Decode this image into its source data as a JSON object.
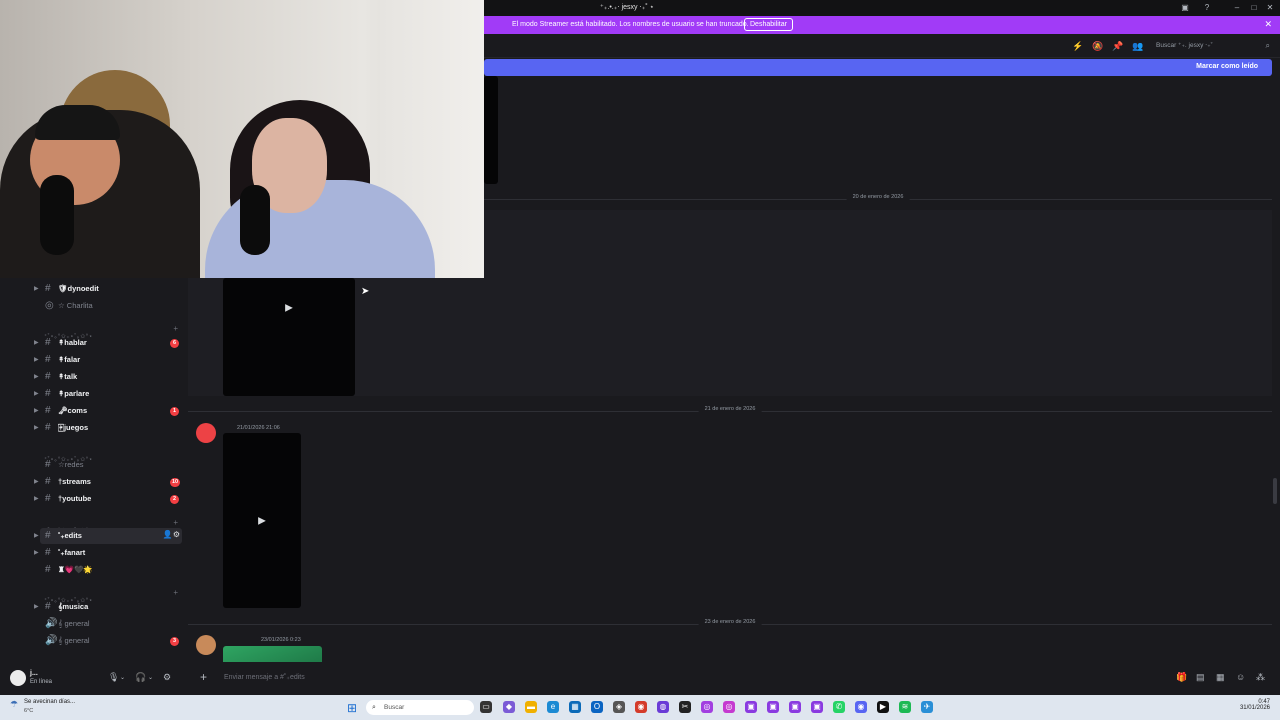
{
  "window": {
    "title": "⁺₊.•.₊‧ jesxy ‧₊˚ ⋆"
  },
  "streamer_banner": {
    "message": "El modo Streamer está habilitado. Los nombres de usuario se han truncado.",
    "disable_label": "Deshabilitar"
  },
  "header": {
    "search_placeholder": "Buscar ⁺₊. jesxy ‧₊˚"
  },
  "unread_bar": {
    "label": "Marcar como leído"
  },
  "sidebar": {
    "items": [
      {
        "type": "channel",
        "name": "🛡︎dynoedit",
        "bold": true,
        "arrow": true
      },
      {
        "type": "voice",
        "name": "☆ Charlita",
        "muted": true
      },
      {
        "type": "category",
        "name": "⁺˚⋆｡°✩₊⋆˚｡✩°⋆"
      },
      {
        "type": "channel",
        "name": "↟hablar",
        "bold": true,
        "arrow": true,
        "badge": "6"
      },
      {
        "type": "channel",
        "name": "↟falar",
        "bold": true,
        "arrow": true
      },
      {
        "type": "channel",
        "name": "↟talk",
        "bold": true,
        "arrow": true
      },
      {
        "type": "channel",
        "name": "↟parlare",
        "bold": true,
        "arrow": true
      },
      {
        "type": "channel",
        "name": "🗝︎coms",
        "bold": true,
        "arrow": true,
        "badge": "1"
      },
      {
        "type": "channel",
        "name": "🀄︎juegos",
        "bold": true,
        "arrow": true
      },
      {
        "type": "category",
        "name": "⁺˚⋆｡°✩₊⋆˚｡✩°⋆"
      },
      {
        "type": "channel",
        "name": "☆redes",
        "muted": true
      },
      {
        "type": "channel",
        "name": "†streams",
        "bold": true,
        "arrow": true,
        "badge": "10"
      },
      {
        "type": "channel",
        "name": "†youtube",
        "bold": true,
        "arrow": true,
        "badge": "2"
      },
      {
        "type": "category",
        "name": "⁺˚⋆｡°✩₊⋆˚｡✩°⋆"
      },
      {
        "type": "channel",
        "name": "˚₊edits",
        "bold": true,
        "arrow": true,
        "active": true
      },
      {
        "type": "channel",
        "name": "˚₊fanart",
        "bold": true,
        "arrow": true
      },
      {
        "type": "channel",
        "name": "♜💗🖤🌟",
        "muted": false
      },
      {
        "type": "category",
        "name": "⁺˚⋆｡°✩₊⋆˚｡✩°⋆"
      },
      {
        "type": "channel",
        "name": "𝄞musica",
        "bold": true,
        "arrow": true
      },
      {
        "type": "voice",
        "name": "𝄞 general",
        "muted": true
      },
      {
        "type": "voice",
        "name": "𝄞 general",
        "muted": true,
        "badge": "3"
      }
    ]
  },
  "user_panel": {
    "name": "j...",
    "status": "En línea"
  },
  "chat": {
    "date_dividers": [
      "20 de enero de 2026",
      "21 de enero de 2026",
      "23 de enero de 2026"
    ],
    "messages": [
      {
        "timestamp": "21/01/2026 21:06"
      },
      {
        "timestamp": "23/01/2026 0:23"
      }
    ]
  },
  "composer": {
    "placeholder": "Enviar mensaje a #˚₊edits"
  },
  "taskbar": {
    "weather_title": "Se avecinan días...",
    "weather_temp": "6°C",
    "search_label": "Buscar",
    "time": "0:47",
    "date": "31/01/2026"
  },
  "colors": {
    "accent": "#5865f2",
    "streamer": "#a13bf7",
    "badge": "#f23f43",
    "bg": "#1a1a1e"
  }
}
